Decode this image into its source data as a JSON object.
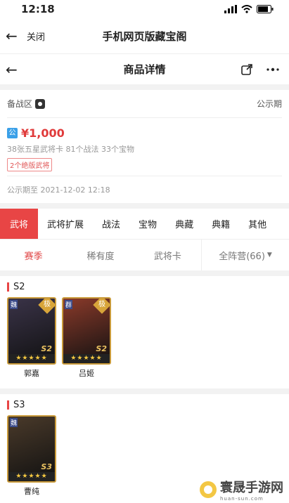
{
  "status": {
    "time": "12:18"
  },
  "nav": {
    "close_label": "关闭",
    "title": "手机网页版藏宝阁"
  },
  "detail": {
    "title": "商品详情"
  },
  "server": {
    "label": "备战区",
    "period_label": "公示期"
  },
  "listing": {
    "tag": "公",
    "price": "¥1,000",
    "summary": "38张五星武将卡  81个战法  33个宝物",
    "badge": "2个绝版武将",
    "date": "公示期至  2021-12-02 12:18"
  },
  "tabs": [
    "武将",
    "武将扩展",
    "战法",
    "宝物",
    "典藏",
    "典籍",
    "其他"
  ],
  "subtabs": [
    "赛季",
    "稀有度",
    "武将卡",
    "全阵营(66)"
  ],
  "sections": [
    {
      "title": "S2",
      "cards": [
        {
          "name": "郭嘉",
          "camp": "魏",
          "rank": "极",
          "season": "S2",
          "stars": "★★★★★",
          "color": "#3a3348"
        },
        {
          "name": "吕姬",
          "camp": "群",
          "rank": "极",
          "season": "S2",
          "stars": "★★★★★",
          "color": "#8a3a2a"
        }
      ]
    },
    {
      "title": "S3",
      "cards": [
        {
          "name": "曹纯",
          "camp": "魏",
          "rank": "",
          "season": "S3",
          "stars": "★★★★★",
          "color": "#4a3a2a"
        }
      ]
    }
  ],
  "watermark": {
    "text": "寰晟手游网",
    "url": "huan-sun.com"
  }
}
